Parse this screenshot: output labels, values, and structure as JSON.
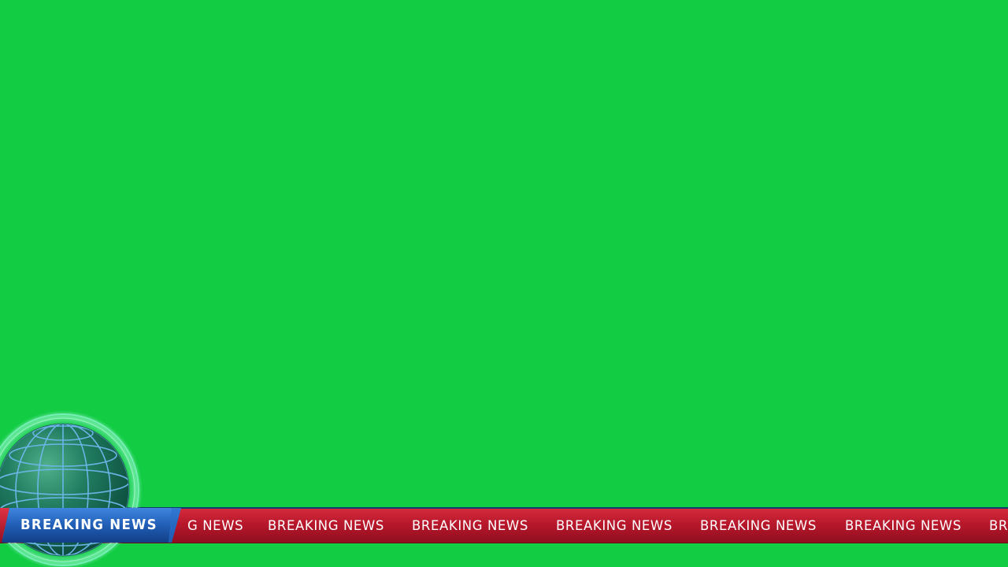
{
  "lower_third": {
    "label": "BREAKING NEWS",
    "ticker_items": [
      "G NEWS",
      "BREAKING NEWS",
      "BREAKING NEWS",
      "BREAKING NEWS",
      "BREAKING NEWS",
      "BREAKING NEWS",
      "BR"
    ]
  },
  "globe": {
    "icon": "globe-icon"
  },
  "colors": {
    "background_chroma": "#12cc44",
    "label_blue": "#1f5fb4",
    "ticker_red": "#b8172b",
    "text": "#ffffff"
  }
}
